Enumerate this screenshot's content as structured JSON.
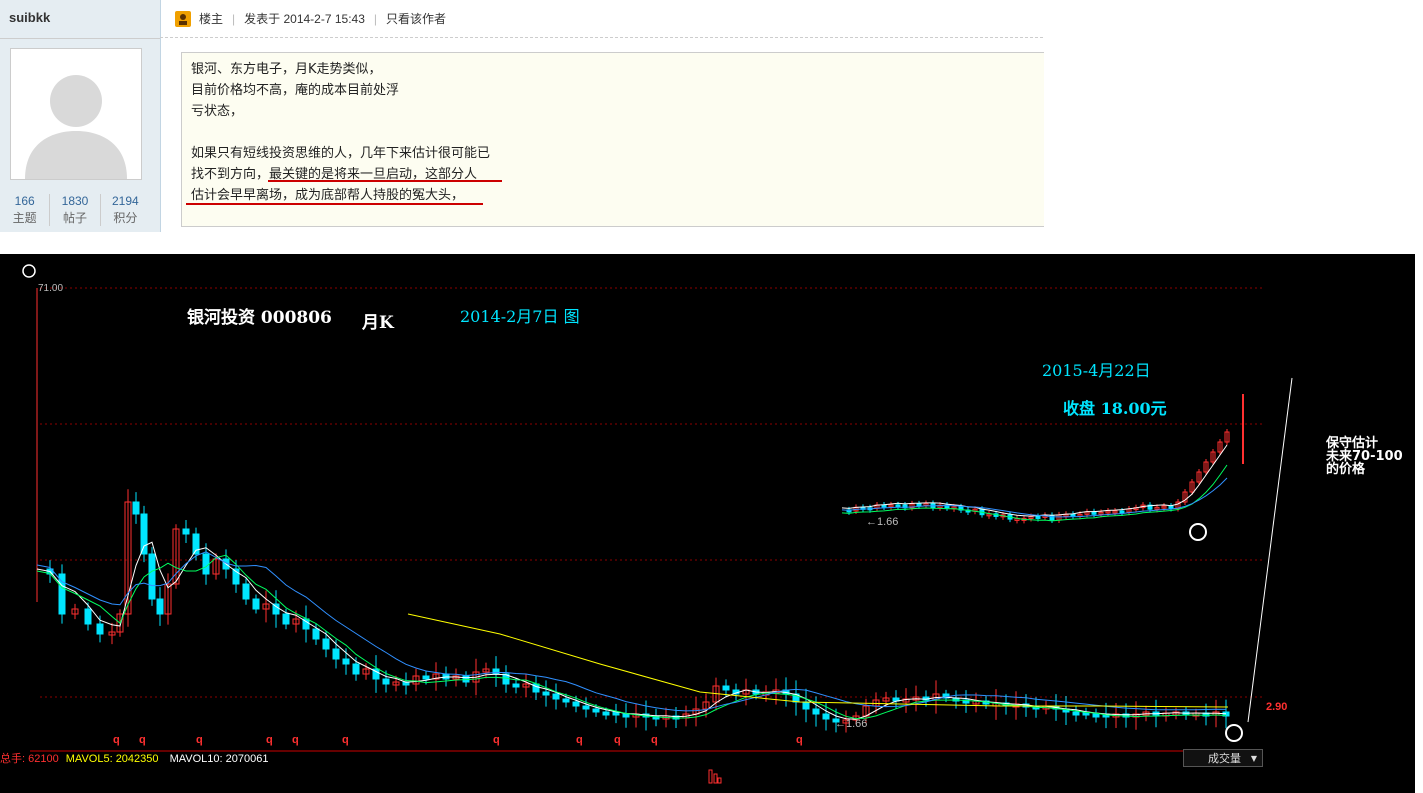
{
  "forum": {
    "username": "suibkk",
    "stats": [
      {
        "value": "166",
        "label": "主题"
      },
      {
        "value": "1830",
        "label": "帖子"
      },
      {
        "value": "2194",
        "label": "积分"
      }
    ],
    "post_meta": {
      "role": "楼主",
      "posted": "发表于 2014-2-7 15:43",
      "only_author": "只看该作者"
    },
    "quote_lines": [
      "银河、东方电子，月K走势类似，",
      "目前价格均不高，庵的成本目前处浮",
      "亏状态，",
      "",
      "如果只有短线投资思维的人，几年下来估计很可能已",
      "找不到方向，最关键的是将来一旦启动，这部分人",
      "估计会早早离场，成为底部帮人持股的冤大头，"
    ]
  },
  "chart": {
    "title": "银河投资 000806",
    "period": "月K",
    "date_label": "2014-2月7日 图",
    "date_label_2": "2015-4月22日",
    "close_label": "收盘 18.00元",
    "annotation_lines": [
      "保守估计",
      "未来70-100",
      "的价格"
    ],
    "max_label": "71.00",
    "min_label": "1.66",
    "price_label": "2.90",
    "volume": {
      "total_label": "总手: 62100",
      "mavol5": "MAVOL5: 2042350",
      "mavol10": "MAVOL10: 2070061",
      "selector": "成交量"
    },
    "q_mark": "q",
    "colors": {
      "up": "#ff3030",
      "down": "#00e5ff",
      "ma_white": "#ffffff",
      "ma_yellow": "#ffff00",
      "ma_green": "#00ff60",
      "ma_blue": "#3090ff",
      "grid": "#8b0000"
    }
  }
}
